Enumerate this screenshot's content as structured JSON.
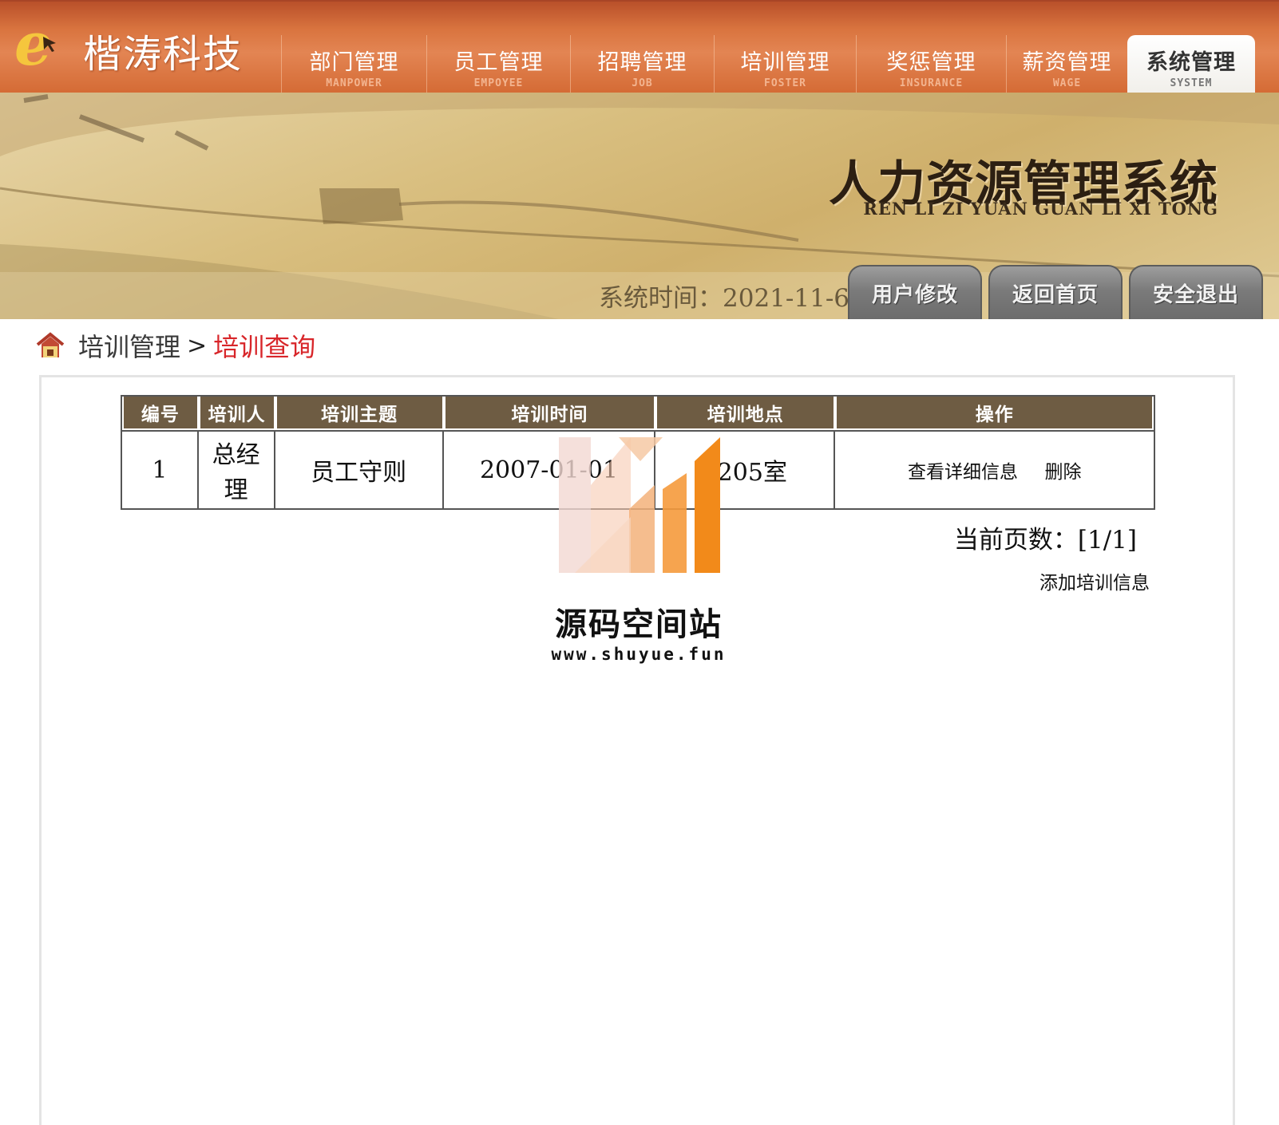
{
  "header": {
    "brand": "楷涛科技",
    "nav": [
      {
        "label": "部门管理",
        "sub": "MANPOWER",
        "active": false
      },
      {
        "label": "员工管理",
        "sub": "EMPOYEE",
        "active": false
      },
      {
        "label": "招聘管理",
        "sub": "JOB",
        "active": false
      },
      {
        "label": "培训管理",
        "sub": "FOSTER",
        "active": false
      },
      {
        "label": "奖惩管理",
        "sub": "INSURANCE",
        "active": false
      },
      {
        "label": "薪资管理",
        "sub": "WAGE",
        "active": false
      },
      {
        "label": "系统管理",
        "sub": "SYSTEM",
        "active": true
      }
    ]
  },
  "banner": {
    "title": "人力资源管理系统",
    "subtitle": "REN LI ZI YUAN GUAN LI XI TONG",
    "time_label": "系统时间：",
    "time_value": "2021-11-6",
    "buttons": [
      "用户修改",
      "返回首页",
      "安全退出"
    ]
  },
  "breadcrumb": {
    "parent": "培训管理",
    "separator": ">",
    "current": "培训查询"
  },
  "table": {
    "headers": [
      "编号",
      "培训人",
      "培训主题",
      "培训时间",
      "培训地点",
      "操作"
    ],
    "rows": [
      {
        "id": "1",
        "trainer": "总经理",
        "topic": "员工守则",
        "time": "2007-01-01",
        "place": "2205室",
        "action_view": "查看详细信息",
        "action_delete": "删除"
      }
    ]
  },
  "pager": {
    "label": "当前页数：",
    "value": "[1/1]"
  },
  "add_link": "添加培训信息",
  "watermark": {
    "name": "源码空间站",
    "url": "www.shuyue.fun"
  },
  "colors": {
    "nav_orange": "#d9743f",
    "table_header": "#6e5c43",
    "breadcrumb_current": "#d8262a",
    "logo_yellow": "#f5c63d",
    "watermark_orange": "#f28a1a"
  }
}
